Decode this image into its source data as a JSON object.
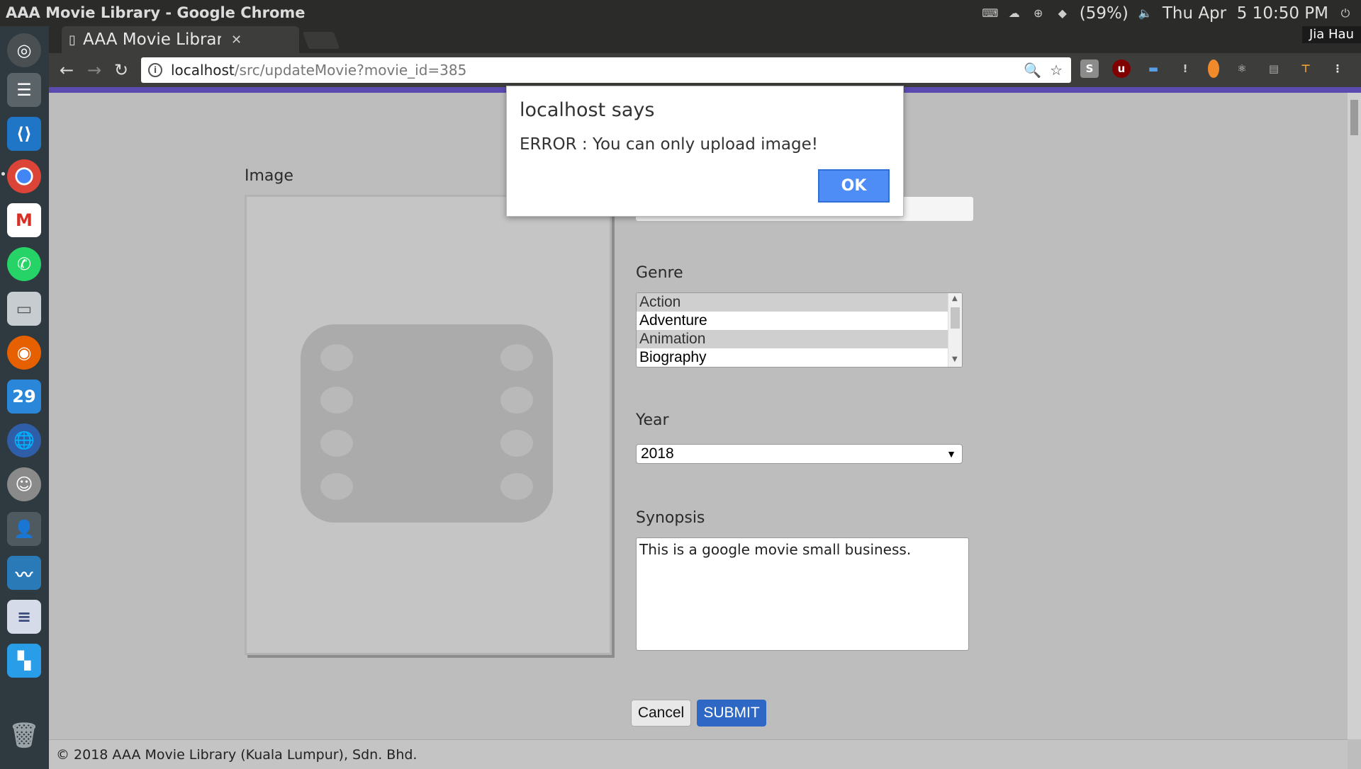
{
  "window": {
    "title": "AAA Movie Library - Google Chrome"
  },
  "tray": {
    "battery": "(59%)",
    "clock": "Thu Apr  5 10:50 PM"
  },
  "launcher": {
    "calendar_day": "29"
  },
  "browser": {
    "tab_title": "AAA Movie Library",
    "profile": "Jia Hau",
    "url_host": "localhost",
    "url_path": "/src/updateMovie?movie_id=385",
    "accent_color": "#5b4bb1"
  },
  "form": {
    "image_label": "Image",
    "genre_label": "Genre",
    "genre_options": [
      "Action",
      "Adventure",
      "Animation",
      "Biography"
    ],
    "year_label": "Year",
    "year_value": "2018",
    "synopsis_label": "Synopsis",
    "synopsis_value": "This is a google movie small business.",
    "cancel_label": "Cancel",
    "submit_label": "SUBMIT",
    "submit_color": "#2f68c4"
  },
  "footer": {
    "text": "© 2018 AAA Movie Library (Kuala Lumpur), Sdn. Bhd."
  },
  "dialog": {
    "title": "localhost says",
    "message": "ERROR : You can only upload image!",
    "ok_label": "OK",
    "ok_color": "#4d8df5"
  }
}
